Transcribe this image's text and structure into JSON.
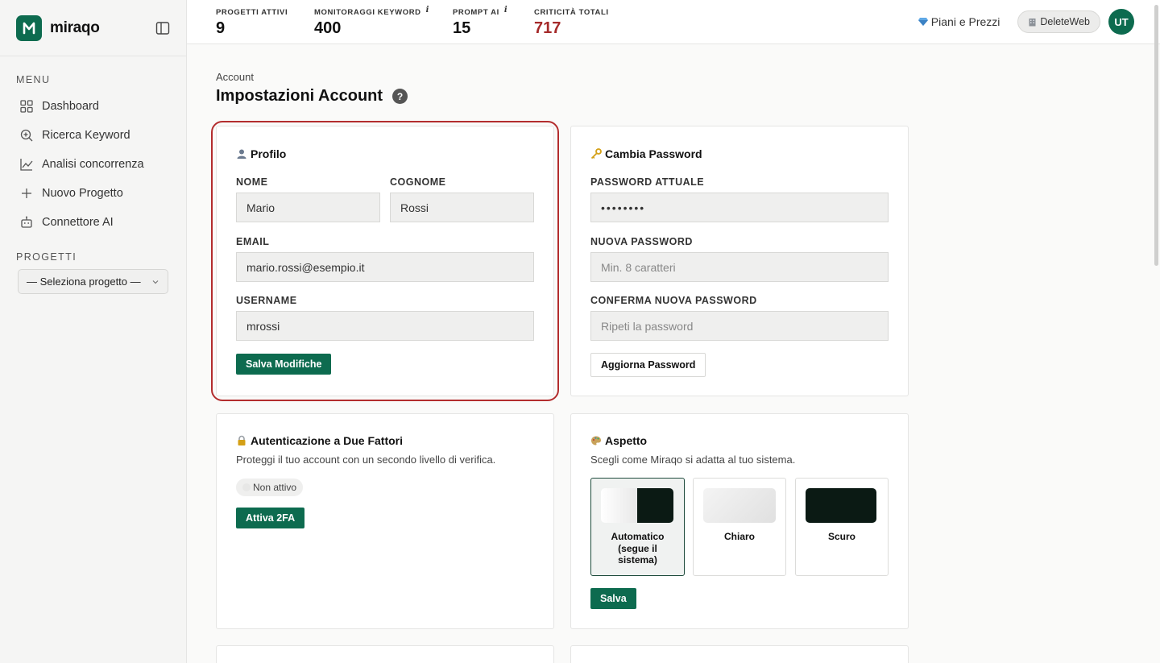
{
  "brand": {
    "name": "miraqo"
  },
  "sidebar": {
    "menu_label": "MENU",
    "items": [
      {
        "label": "Dashboard",
        "icon": "grid-icon"
      },
      {
        "label": "Ricerca Keyword",
        "icon": "search-plus-icon"
      },
      {
        "label": "Analisi concorrenza",
        "icon": "line-chart-icon"
      },
      {
        "label": "Nuovo Progetto",
        "icon": "plus-icon"
      },
      {
        "label": "Connettore AI",
        "icon": "robot-icon"
      }
    ],
    "projects_label": "PROGETTI",
    "project_select": "— Seleziona progetto —"
  },
  "topbar": {
    "stats": [
      {
        "label": "PROGETTI ATTIVI",
        "value": "9",
        "info": ""
      },
      {
        "label": "MONITORAGGI KEYWORD",
        "value": "400",
        "info": "i"
      },
      {
        "label": "PROMPT AI",
        "value": "15",
        "info": "i"
      },
      {
        "label": "CRITICITÀ TOTALI",
        "value": "717",
        "info": ""
      }
    ],
    "plans_label": "Piani e Prezzi",
    "workspace_label": "DeleteWeb",
    "avatar_initials": "UT"
  },
  "page": {
    "breadcrumb": "Account",
    "title": "Impostazioni Account",
    "help": "?"
  },
  "profile": {
    "title": "Profilo",
    "first_name_label": "NOME",
    "first_name": "Mario",
    "last_name_label": "COGNOME",
    "last_name": "Rossi",
    "email_label": "EMAIL",
    "email": "mario.rossi@esempio.it",
    "username_label": "USERNAME",
    "username": "mrossi",
    "save_label": "Salva Modifiche"
  },
  "password": {
    "title": "Cambia Password",
    "current_label": "PASSWORD ATTUALE",
    "current_value": "••••••••",
    "new_label": "NUOVA PASSWORD",
    "new_placeholder": "Min. 8 caratteri",
    "confirm_label": "CONFERMA NUOVA PASSWORD",
    "confirm_placeholder": "Ripeti la password",
    "update_label": "Aggiorna Password"
  },
  "twofa": {
    "title": "Autenticazione a Due Fattori",
    "desc": "Proteggi il tuo account con un secondo livello di verifica.",
    "status": "Non attivo",
    "activate_label": "Attiva 2FA"
  },
  "appearance": {
    "title": "Aspetto",
    "desc": "Scegli come Miraqo si adatta al tuo sistema.",
    "options": [
      {
        "label": "Automatico (segue il sistema)",
        "selected": true
      },
      {
        "label": "Chiaro",
        "selected": false
      },
      {
        "label": "Scuro",
        "selected": false
      }
    ],
    "save_label": "Salva"
  },
  "colors": {
    "accent": "#0d6b4f",
    "critical": "#a52a2a",
    "highlight": "#b32d2e"
  }
}
